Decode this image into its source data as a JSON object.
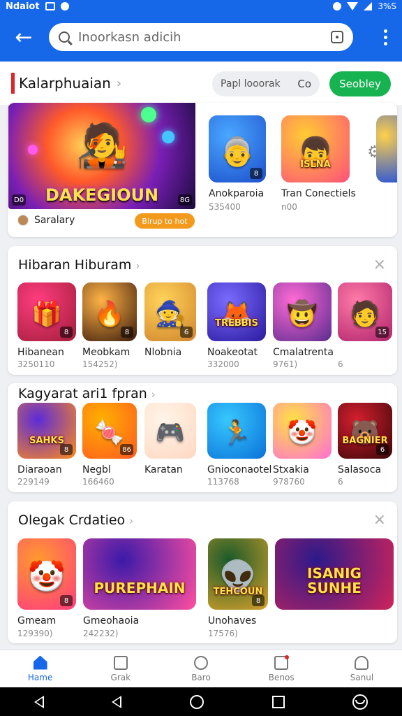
{
  "statusbar": {
    "left_text": "Ndaiot",
    "right_text": "3%S"
  },
  "search": {
    "placeholder": "Inoorkasn adicih"
  },
  "header": {
    "title": "Kalarphuaian",
    "filter_label": "Papl looorak",
    "filter_suffix": "Co",
    "cta_label": "Seobley"
  },
  "featured": {
    "banner_title": "DAKEGIOUN",
    "banner_corner": "8G",
    "banner_left_corner": "D0",
    "developer": "Saralary",
    "badge": "Birup to hot",
    "side_apps": [
      {
        "name": "Anokparoia",
        "meta": "535400",
        "corner": "8",
        "art": "👵",
        "colors": [
          "#4aa7ff",
          "#1d4fcc"
        ]
      },
      {
        "name": "Tran Conectiels",
        "meta": "n00",
        "art": "👦",
        "word": "ISLNA",
        "colors": [
          "#ffcc33",
          "#ff4f7a"
        ]
      }
    ]
  },
  "sections": [
    {
      "title": "Hibaran Hiburam",
      "apps": [
        {
          "name": "Hibanean",
          "meta": "3250110",
          "corner": "8",
          "art": "🎁",
          "colors": [
            "#ff3d7f",
            "#a11d3a"
          ]
        },
        {
          "name": "Meobkam",
          "meta": "154252)",
          "corner": "8",
          "art": "🔥",
          "colors": [
            "#ffb347",
            "#3a1a0a"
          ]
        },
        {
          "name": "Nlobnia",
          "meta": "",
          "corner": "6",
          "art": "🧙",
          "colors": [
            "#ffd35a",
            "#d0842c"
          ]
        },
        {
          "name": "Noakeotat",
          "meta": "332000",
          "art": "🦊",
          "word": "TREBBIS",
          "colors": [
            "#7a6bff",
            "#2a1a9e"
          ]
        },
        {
          "name": "Cmalatrenta",
          "meta": "9761)",
          "art": "🤠",
          "colors": [
            "#ff6ad5",
            "#5b2b8f"
          ]
        },
        {
          "name": "",
          "meta": "6",
          "corner": "15",
          "art": "🧑",
          "colors": [
            "#ff7aa8",
            "#b0236b"
          ]
        }
      ]
    },
    {
      "title": "Kagyarat ari1 fpran",
      "apps": [
        {
          "name": "Diaraoan",
          "meta": "229149",
          "corner": "8",
          "art": "",
          "word": "SAHKS",
          "colors": [
            "#5c2bd8",
            "#ff8c1a"
          ]
        },
        {
          "name": "Negbl",
          "meta": "166460",
          "corner": "86",
          "art": "🍬",
          "colors": [
            "#ffb000",
            "#ff5a1f"
          ]
        },
        {
          "name": "Karatan",
          "meta": "",
          "art": "🎮",
          "colors": [
            "#fff5e8",
            "#ffd7c2"
          ]
        },
        {
          "name": "Gnioconaotel",
          "meta": "113768",
          "art": "🏃",
          "colors": [
            "#37c7ff",
            "#0a72d8"
          ]
        },
        {
          "name": "Stxakia",
          "meta": "978760",
          "art": "🤡",
          "colors": [
            "#ffe144",
            "#ff6ed3"
          ]
        },
        {
          "name": "Salasoca",
          "meta": "6",
          "corner": "6",
          "art": "🐻",
          "word": "BAGNIER",
          "colors": [
            "#d41f2e",
            "#3a0608"
          ]
        }
      ]
    },
    {
      "title": "Olegak Crdatieo",
      "apps": [
        {
          "name": "Gmeam",
          "meta": "129390)",
          "corner": "8",
          "art": "🤡",
          "colors": [
            "#ff9a2e",
            "#ff3b7f"
          ]
        },
        {
          "name": "Gmeohaoia",
          "meta": "242232)",
          "art": "",
          "word": "PUREPHAIN",
          "colors": [
            "#3a1aa8",
            "#ff4fa0"
          ]
        },
        {
          "name": "Unohaves",
          "meta": "17576)",
          "corner": "8",
          "art": "👽",
          "word": "TEHCOUN",
          "colors": [
            "#1a5a2a",
            "#d6a12a"
          ]
        },
        {
          "name": "",
          "meta": "",
          "art": "",
          "word": "ISANIG SUNHE",
          "colors": [
            "#2b1a8a",
            "#d0245a"
          ]
        }
      ]
    }
  ],
  "bottomnav": [
    {
      "label": "Hame",
      "active": true
    },
    {
      "label": "Grak"
    },
    {
      "label": "Baro"
    },
    {
      "label": "Benos"
    },
    {
      "label": "Sanul"
    }
  ]
}
